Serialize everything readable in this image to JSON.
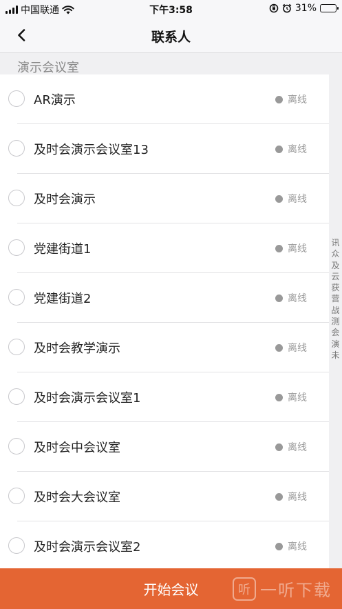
{
  "status_bar": {
    "carrier": "中国联通",
    "time": "下午3:58",
    "battery_percent": "31%",
    "battery_level": 0.31,
    "battery_color": "#36c759"
  },
  "nav": {
    "title": "联系人",
    "back_icon": "chevron-left-icon"
  },
  "section": {
    "header": "演示会议室"
  },
  "contacts": [
    {
      "name": "AR演示",
      "status": "离线"
    },
    {
      "name": "及时会演示会议室13",
      "status": "离线"
    },
    {
      "name": "及时会演示",
      "status": "离线"
    },
    {
      "name": "党建街道1",
      "status": "离线"
    },
    {
      "name": "党建街道2",
      "status": "离线"
    },
    {
      "name": "及时会教学演示",
      "status": "离线"
    },
    {
      "name": "及时会演示会议室1",
      "status": "离线"
    },
    {
      "name": "及时会中会议室",
      "status": "离线"
    },
    {
      "name": "及时会大会议室",
      "status": "离线"
    },
    {
      "name": "及时会演示会议室2",
      "status": "离线"
    }
  ],
  "index_letters": [
    "讯",
    "众",
    "及",
    "云",
    "获",
    "营",
    "战",
    "测",
    "会",
    "演",
    "未"
  ],
  "start_button": {
    "label": "开始会议",
    "color": "#e46533"
  },
  "watermark": {
    "logo_glyph": "听",
    "text": "一听下载"
  }
}
